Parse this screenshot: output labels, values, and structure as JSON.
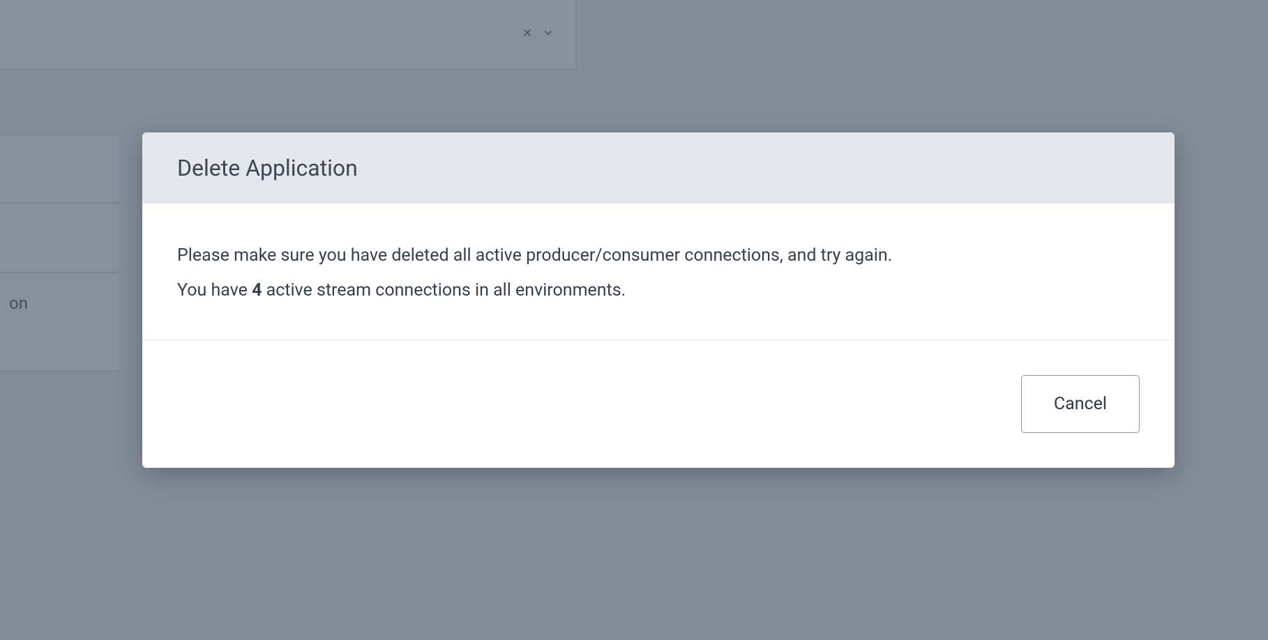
{
  "background": {
    "sidebar_item_text": "on"
  },
  "modal": {
    "title": "Delete Application",
    "body_line1": "Please make sure you have deleted all active producer/consumer connections, and try again.",
    "body_line2_pre": "You have ",
    "body_line2_count": "4",
    "body_line2_post": " active stream connections in all environments.",
    "cancel_label": "Cancel"
  }
}
